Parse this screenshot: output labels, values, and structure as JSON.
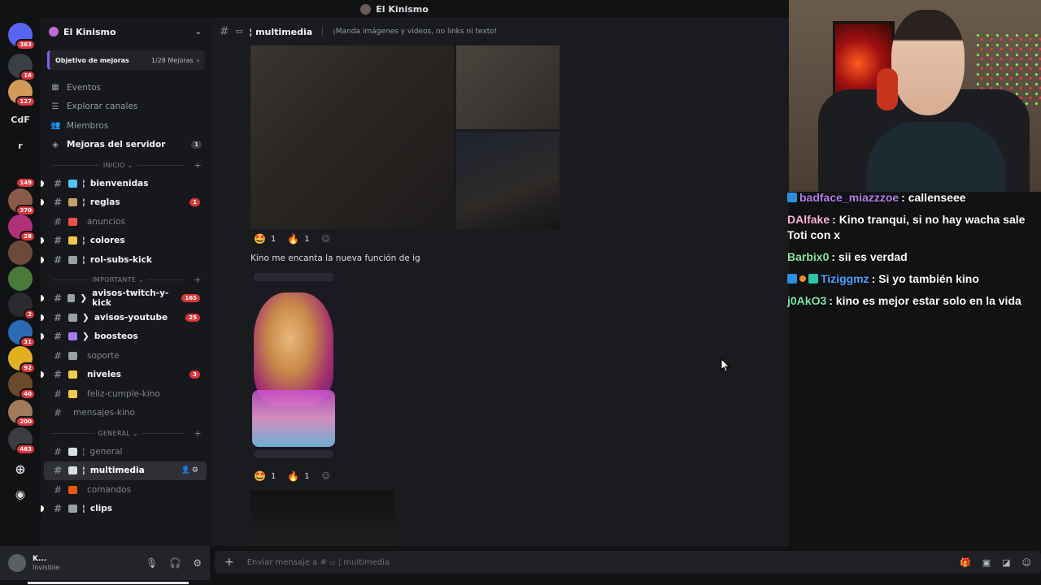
{
  "window": {
    "title": "El Kinismo"
  },
  "rail": {
    "servers": [
      {
        "label": "",
        "badge": "363",
        "color": "#5865f2"
      },
      {
        "label": "",
        "badge": "16",
        "color": "#3b3f45"
      },
      {
        "label": "",
        "badge": "127",
        "color": "#d19a5b"
      },
      {
        "label": "CdF",
        "badge": "",
        "color": "#111214"
      },
      {
        "label": "r",
        "badge": "",
        "color": "#111214"
      },
      {
        "label": "",
        "badge": "149",
        "color": "#111214"
      },
      {
        "label": "",
        "badge": "370",
        "color": "#8c5a4a"
      },
      {
        "label": "",
        "badge": "28",
        "color": "#b0307a"
      },
      {
        "label": "",
        "badge": "",
        "color": "#6b4a3a"
      },
      {
        "label": "",
        "badge": "",
        "color": "#4a7a3a"
      },
      {
        "label": "",
        "badge": "2",
        "color": "#2a2b2f"
      },
      {
        "label": "",
        "badge": "31",
        "color": "#2c6bb3"
      },
      {
        "label": "",
        "badge": "92",
        "color": "#e0b020"
      },
      {
        "label": "",
        "badge": "40",
        "color": "#6a4a2a"
      },
      {
        "label": "",
        "badge": "200",
        "color": "#a07a5a"
      },
      {
        "label": "",
        "badge": "483",
        "color": "#3a3c42"
      }
    ],
    "add_icon": "plus-icon",
    "discover_icon": "compass-icon"
  },
  "sidebar": {
    "guild_name": "El Kinismo",
    "boost_goal": {
      "label": "Objetivo de mejoras",
      "count": "1/28 Mejoras"
    },
    "nav": [
      {
        "label": "Eventos",
        "icon": "calendar-icon",
        "badge": ""
      },
      {
        "label": "Explorar canales",
        "icon": "list-icon",
        "badge": ""
      },
      {
        "label": "Miembros",
        "icon": "members-icon",
        "badge": ""
      },
      {
        "label": "Mejoras del servidor",
        "icon": "boost-icon",
        "badge": "1"
      }
    ],
    "categories": [
      {
        "name": "INICIO",
        "channels": [
          {
            "name": "bienvenidas",
            "prefix": "¦",
            "emoji_color": "#4fc3f7",
            "unread": true,
            "badge": ""
          },
          {
            "name": "reglas",
            "prefix": "¦",
            "emoji_color": "#c9a06b",
            "unread": true,
            "badge": "1"
          },
          {
            "name": "anuncios",
            "prefix": "",
            "emoji_color": "#f04d4d",
            "unread": false,
            "badge": ""
          },
          {
            "name": "colores",
            "prefix": "¦",
            "emoji_color": "#f2c94c",
            "unread": true,
            "badge": ""
          },
          {
            "name": "rol-subs-kick",
            "prefix": "¦",
            "emoji_color": "#9aa0a6",
            "unread": true,
            "badge": ""
          }
        ]
      },
      {
        "name": "IMPORTANTE",
        "channels": [
          {
            "name": "avisos-twitch-y-kick",
            "prefix": "❯",
            "emoji_color": "#9aa0a6",
            "unread": true,
            "badge": "165"
          },
          {
            "name": "avisos-youtube",
            "prefix": "❯",
            "emoji_color": "#9aa0a6",
            "unread": true,
            "badge": "25"
          },
          {
            "name": "boosteos",
            "prefix": "❯",
            "emoji_color": "#a77bf3",
            "unread": true,
            "badge": ""
          },
          {
            "name": "soporte",
            "prefix": "",
            "emoji_color": "#9aa0a6",
            "unread": false,
            "badge": ""
          },
          {
            "name": "niveles",
            "prefix": "",
            "emoji_color": "#f2c94c",
            "unread": true,
            "badge": "3"
          },
          {
            "name": "feliz-cumple-kino",
            "prefix": "",
            "emoji_color": "#f2c94c",
            "unread": false,
            "badge": ""
          },
          {
            "name": "mensajes-kino",
            "prefix": "",
            "emoji_color": "",
            "unread": false,
            "badge": ""
          }
        ]
      },
      {
        "name": "GENERAL",
        "channels": [
          {
            "name": "general",
            "prefix": "¦",
            "emoji_color": "#dbdee1",
            "unread": false,
            "badge": ""
          },
          {
            "name": "multimedia",
            "prefix": "¦",
            "emoji_color": "#dbdee1",
            "unread": false,
            "badge": "",
            "selected": true
          },
          {
            "name": "comandos",
            "prefix": "",
            "emoji_color": "#e8590c",
            "unread": false,
            "badge": ""
          },
          {
            "name": "clips",
            "prefix": "¦",
            "emoji_color": "#9aa0a6",
            "unread": true,
            "badge": ""
          }
        ]
      }
    ]
  },
  "user_panel": {
    "name": "K...",
    "status": "Invisible"
  },
  "channel": {
    "name": "¦ multimedia",
    "topic": "¡Manda imágenes y videos, no links ni texto!"
  },
  "messages": {
    "reactions_1": [
      {
        "emoji": "🤩",
        "count": "1"
      },
      {
        "emoji": "🔥",
        "count": "1"
      }
    ],
    "text_2": "Kino me encanta la nueva función de ig",
    "reactions_2": [
      {
        "emoji": "🤩",
        "count": "1"
      },
      {
        "emoji": "🔥",
        "count": "1"
      }
    ]
  },
  "composer": {
    "placeholder": "Enviar mensaje a #",
    "channel": "¦ multimedia"
  },
  "twitch_chat": [
    {
      "user": "badface_miazzzoe",
      "color": "#b57ce8",
      "text": ": callenseee",
      "badges": [
        "b"
      ]
    },
    {
      "user": "DAlfake",
      "color": "#ffb3d9",
      "text": ": Kino tranqui, si no hay wacha sale Toti con x",
      "badges": []
    },
    {
      "user": "Barbix0",
      "color": "#8ee8a0",
      "text": ": sii es verdad",
      "badges": []
    },
    {
      "user": "Tiziggmz",
      "color": "#4fa3ff",
      "text": ": Si yo también kino",
      "badges": [
        "b",
        "o",
        "g"
      ]
    },
    {
      "user": "j0AkO3",
      "color": "#7fe8a8",
      "text": ": kino es mejor estar solo en la vida",
      "badges": []
    }
  ]
}
